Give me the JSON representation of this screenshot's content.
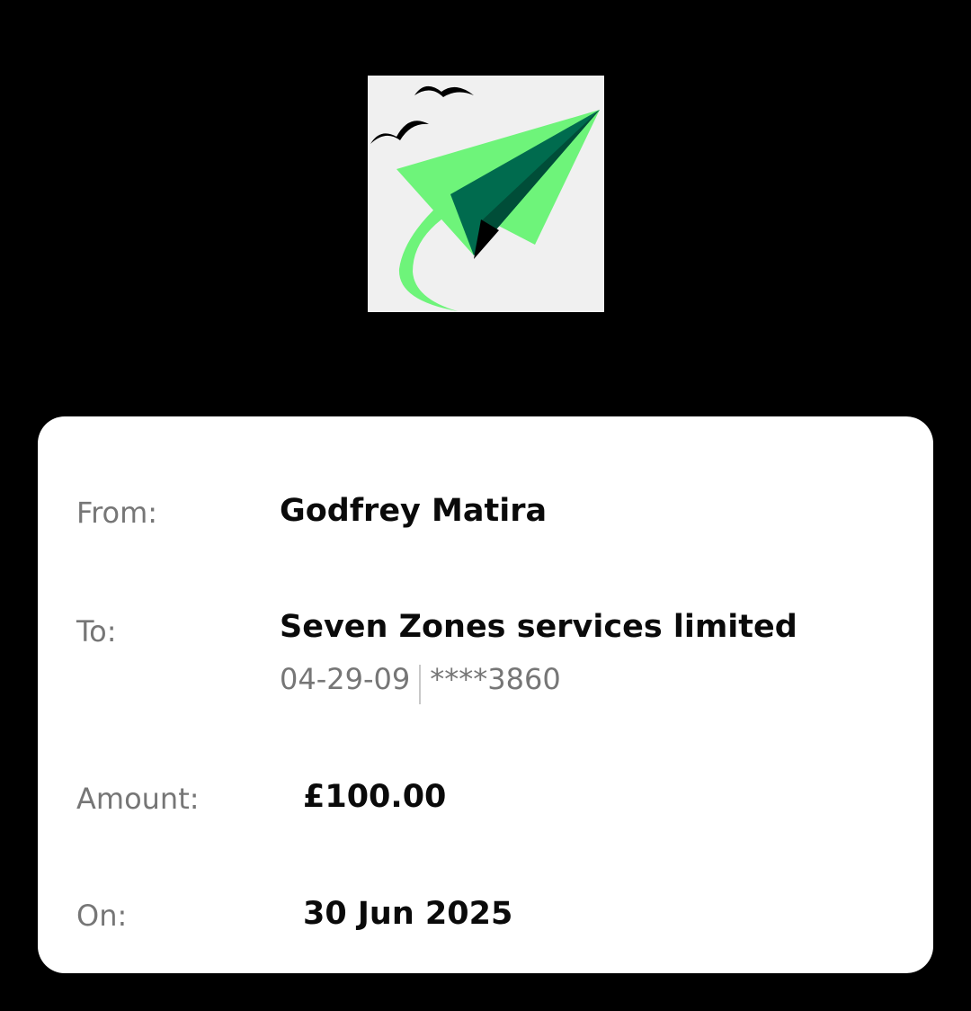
{
  "logo": {
    "icon": "paper-plane-icon",
    "colors": {
      "background": "#f0f0f0",
      "light_green": "#6ef47a",
      "dark_green": "#006b4e",
      "birds": "#000000"
    }
  },
  "transfer": {
    "from_label": "From:",
    "from_value": "Godfrey Matira",
    "to_label": "To:",
    "to_value": "Seven Zones services limited",
    "sort_code": "04-29-09",
    "account_masked": "****3860",
    "amount_label": "Amount:",
    "amount_value": "£100.00",
    "date_label": "On:",
    "date_value": "30 Jun 2025"
  }
}
